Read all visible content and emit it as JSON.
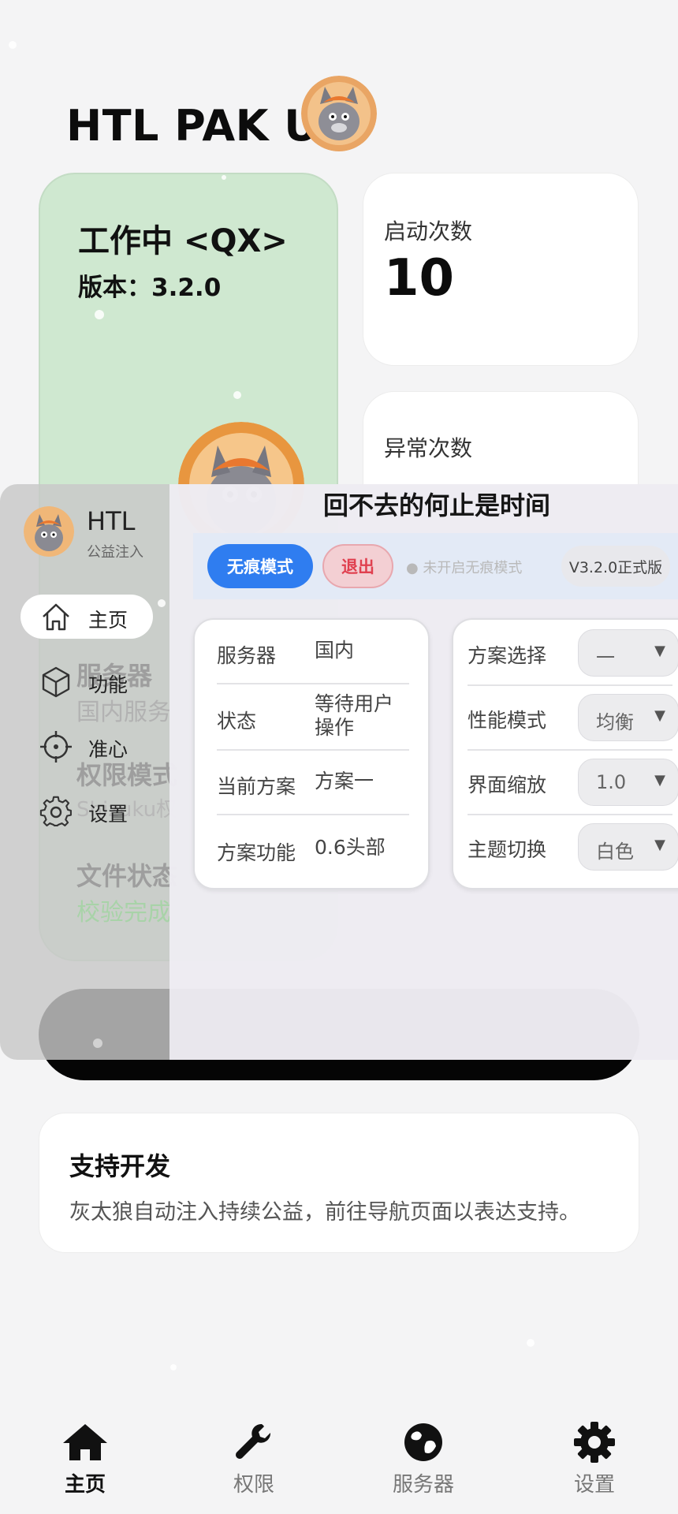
{
  "app": {
    "title": "HTL PAK Ult",
    "status_title": "工作中 <QX>",
    "status_version": "版本：3.2.0",
    "launch_label": "启动次数",
    "launch_value": "10",
    "error_label": "异常次数",
    "faded": {
      "line1": "服务器",
      "line2": "国内服务",
      "line3": "权限模式",
      "line4": "Shizuku权",
      "line5": "文件状态",
      "line6": "校验完成"
    }
  },
  "support": {
    "title": "支持开发",
    "text": "灰太狼自动注入持续公益，前往导航页面以表达支持。"
  },
  "bottom_nav": [
    {
      "label": "主页",
      "icon": "home-icon",
      "active": true
    },
    {
      "label": "权限",
      "icon": "wrench-icon",
      "active": false
    },
    {
      "label": "服务器",
      "icon": "globe-icon",
      "active": false
    },
    {
      "label": "设置",
      "icon": "gear-icon",
      "active": false
    }
  ],
  "overlay": {
    "brand": "HTL",
    "subtitle": "公益注入",
    "heading": "回不去的何止是时间",
    "menu": [
      {
        "label": "主页",
        "icon": "home-outline-icon"
      },
      {
        "label": "功能",
        "icon": "cube-icon"
      },
      {
        "label": "准心",
        "icon": "crosshair-icon"
      },
      {
        "label": "设置",
        "icon": "gear-outline-icon"
      }
    ],
    "incognito_button": "无痕模式",
    "exit_button": "退出",
    "incognito_status": "● 未开启无痕模式",
    "version": "V3.2.0正式版",
    "info": [
      {
        "key": "服务器",
        "value": "国内"
      },
      {
        "key": "状态",
        "value": "等待用户操作"
      },
      {
        "key": "当前方案",
        "value": "方案一"
      },
      {
        "key": "方案功能",
        "value": "0.6头部"
      }
    ],
    "settings": [
      {
        "key": "方案选择",
        "value": "一"
      },
      {
        "key": "性能模式",
        "value": "均衡"
      },
      {
        "key": "界面缩放",
        "value": "1.0"
      },
      {
        "key": "主题切换",
        "value": "白色"
      }
    ],
    "dropdown_arrow": "▼"
  },
  "colors": {
    "status_card": "#cfe8d0",
    "accent_blue": "#2f7df0",
    "exit_red": "#e0404f"
  }
}
